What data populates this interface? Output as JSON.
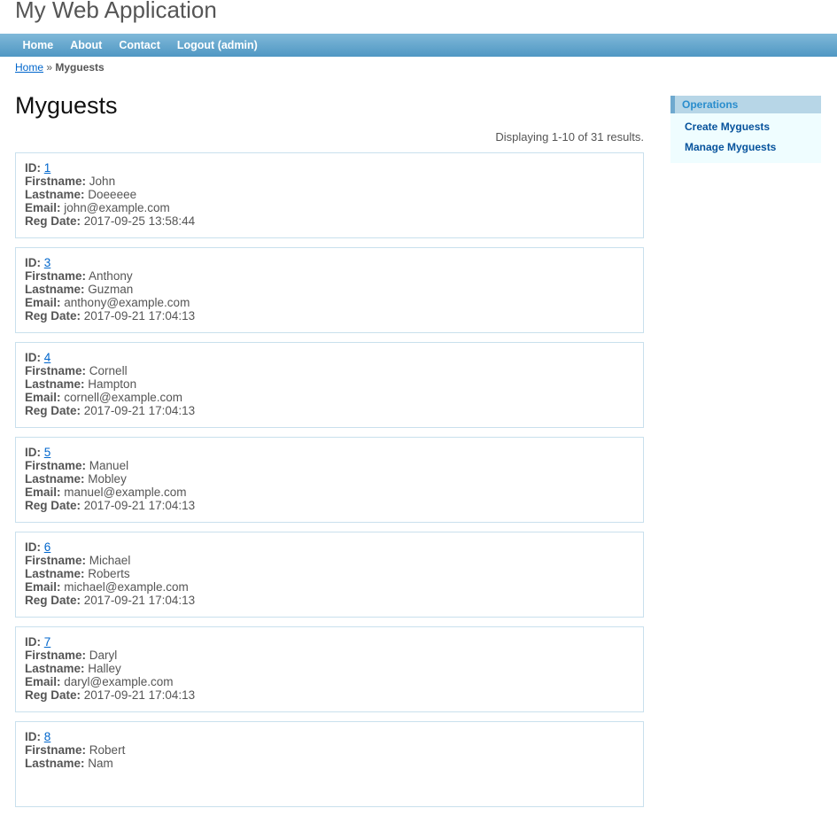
{
  "app_title": "My Web Application",
  "nav": [
    {
      "label": "Home"
    },
    {
      "label": "About"
    },
    {
      "label": "Contact"
    },
    {
      "label": "Logout (admin)"
    }
  ],
  "breadcrumb": {
    "home": "Home",
    "sep": " » ",
    "current": "Myguests"
  },
  "page_title": "Myguests",
  "summary": "Displaying 1-10 of 31 results.",
  "labels": {
    "id": "ID:",
    "firstname": "Firstname:",
    "lastname": "Lastname:",
    "email": "Email:",
    "regdate": "Reg Date:"
  },
  "guests": [
    {
      "id": "1",
      "firstname": "John",
      "lastname": "Doeeeee",
      "email": "john@example.com",
      "regdate": "2017-09-25 13:58:44"
    },
    {
      "id": "3",
      "firstname": "Anthony",
      "lastname": "Guzman",
      "email": "anthony@example.com",
      "regdate": "2017-09-21 17:04:13"
    },
    {
      "id": "4",
      "firstname": "Cornell",
      "lastname": "Hampton",
      "email": "cornell@example.com",
      "regdate": "2017-09-21 17:04:13"
    },
    {
      "id": "5",
      "firstname": "Manuel",
      "lastname": "Mobley",
      "email": "manuel@example.com",
      "regdate": "2017-09-21 17:04:13"
    },
    {
      "id": "6",
      "firstname": "Michael",
      "lastname": "Roberts",
      "email": "michael@example.com",
      "regdate": "2017-09-21 17:04:13"
    },
    {
      "id": "7",
      "firstname": "Daryl",
      "lastname": "Halley",
      "email": "daryl@example.com",
      "regdate": "2017-09-21 17:04:13"
    },
    {
      "id": "8",
      "firstname": "Robert",
      "lastname": "Nam"
    }
  ],
  "sidebar": {
    "title": "Operations",
    "items": [
      {
        "label": "Create Myguests"
      },
      {
        "label": "Manage Myguests"
      }
    ]
  }
}
